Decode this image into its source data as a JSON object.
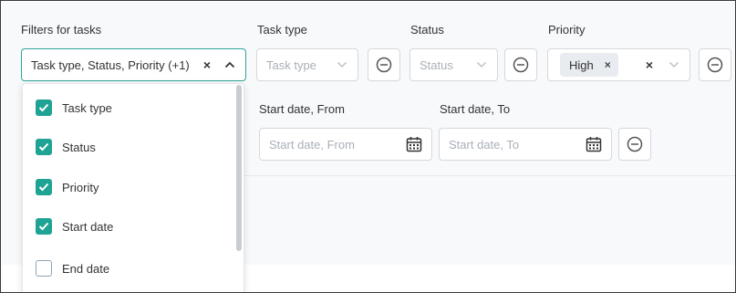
{
  "filters_field": {
    "label": "Filters for tasks",
    "value": "Task type, Status, Priority (+1)"
  },
  "task_type": {
    "label": "Task type",
    "placeholder": "Task type"
  },
  "status": {
    "label": "Status",
    "placeholder": "Status"
  },
  "priority": {
    "label": "Priority",
    "chip": "High"
  },
  "start_date": {
    "from_label": "Start date, From",
    "from_placeholder": "Start date, From",
    "to_label": "Start date, To",
    "to_placeholder": "Start date, To"
  },
  "dropdown": {
    "options": [
      {
        "label": "Task type",
        "checked": true
      },
      {
        "label": "Status",
        "checked": true
      },
      {
        "label": "Priority",
        "checked": true
      },
      {
        "label": "Start date",
        "checked": true
      },
      {
        "label": "End date",
        "checked": false
      }
    ]
  },
  "colors": {
    "accent": "#1fa394",
    "border": "#d5d8de",
    "panel_bg": "#f8f9fb"
  },
  "icons": {
    "clear": "close-icon",
    "caret": "chevron-icon",
    "remove": "minus-circle-icon",
    "calendar": "calendar-icon",
    "check": "check-icon"
  }
}
